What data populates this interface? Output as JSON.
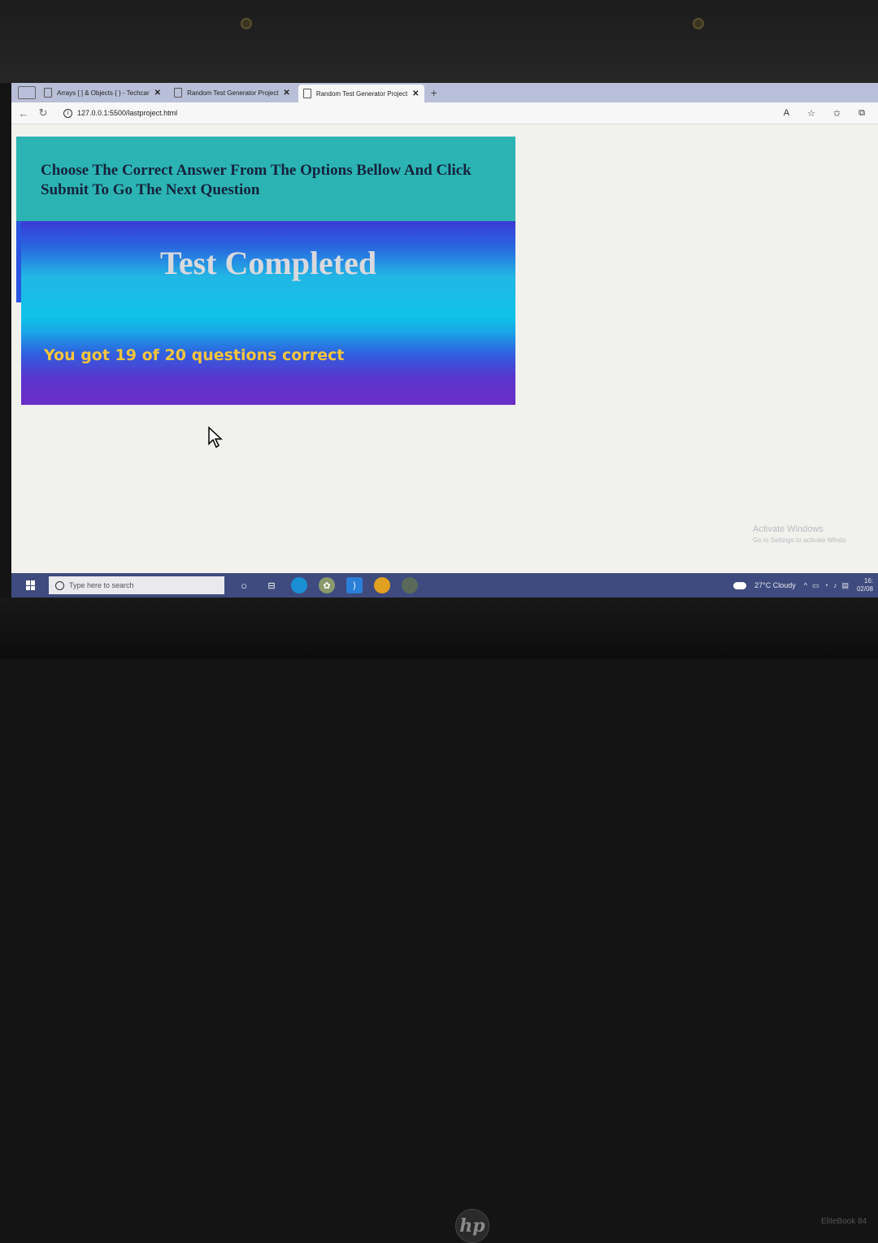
{
  "browser": {
    "tabs": [
      {
        "label": "Arrays [ ] & Objects { } - Techcar",
        "active": false
      },
      {
        "label": "Random Test Generator Project",
        "active": false
      },
      {
        "label": "Random Test Generator Project",
        "active": true
      }
    ],
    "new_tab": "+",
    "url": "127.0.0.1:5500/lastproject.html"
  },
  "page": {
    "instructions": "Choose The Correct Answer From The Options Bellow And Click Submit To Go The Next Question",
    "result_title": "Test Completed",
    "score_text": "You got 19 of 20 questions correct"
  },
  "watermark": {
    "title": "Activate Windows",
    "subtitle": "Go to Settings to activate Windo"
  },
  "taskbar": {
    "search_placeholder": "Type here to search",
    "weather": "27°C Cloudy",
    "time": "16:",
    "date": "02/08"
  },
  "laptop": {
    "brand": "hp",
    "model": "EliteBook 84"
  },
  "colors": {
    "header_bg": "#2bb4b3",
    "score_text": "#f5c53c",
    "taskbar": "#3f4b7e"
  }
}
